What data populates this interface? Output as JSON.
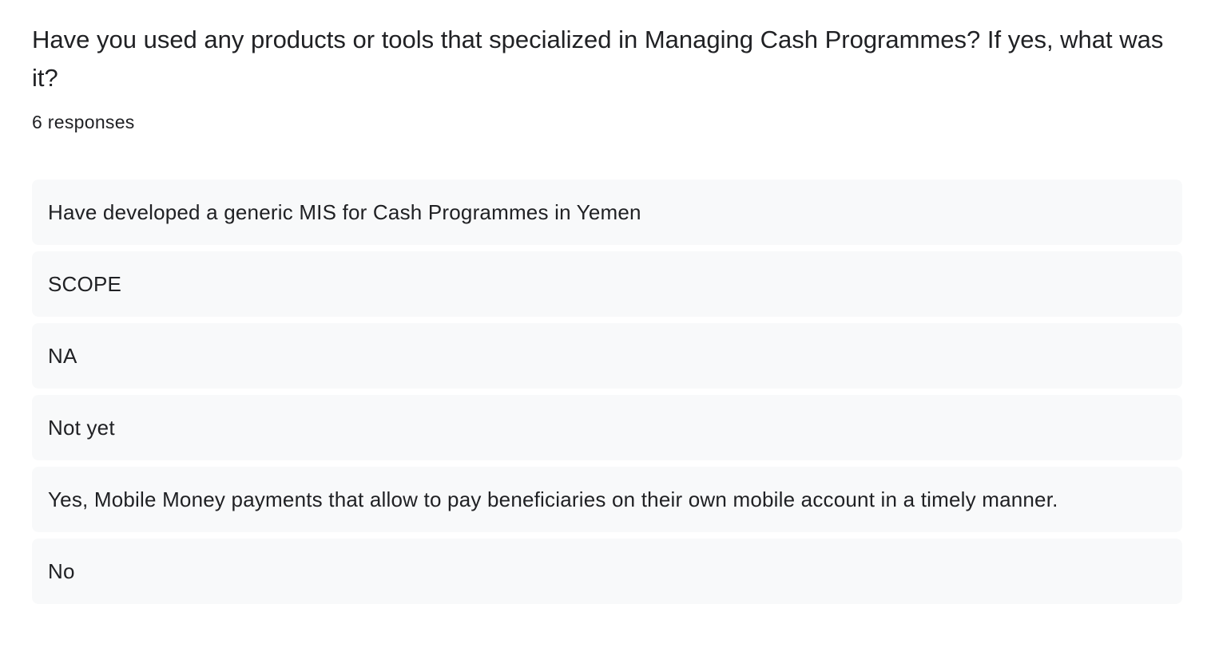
{
  "question": {
    "title": "Have you used any products or tools that specialized in Managing Cash Programmes? If yes, what was it?",
    "response_count": "6 responses"
  },
  "responses": [
    "Have developed a generic MIS for Cash Programmes in Yemen",
    "SCOPE",
    "NA",
    "Not yet",
    "Yes, Mobile Money payments that allow to pay beneficiaries on their own mobile account in a timely manner.",
    "No"
  ]
}
